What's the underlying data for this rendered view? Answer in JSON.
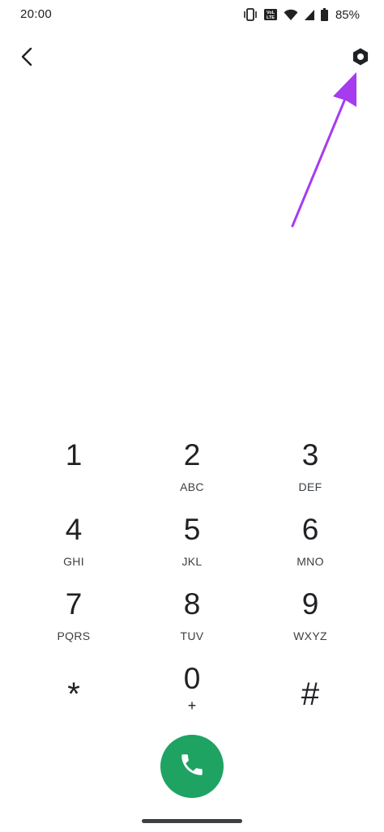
{
  "status_bar": {
    "time": "20:00",
    "battery_percent": "85%",
    "icons": [
      "vibrate-icon",
      "volte-icon",
      "wifi-icon",
      "cell-signal-icon",
      "battery-icon"
    ]
  },
  "app_bar": {
    "back_icon": "chevron-left-icon",
    "settings_icon": "settings-hexagon-icon"
  },
  "annotation": {
    "arrow_color": "#a63bf0"
  },
  "dialpad": {
    "keys": [
      {
        "digit": "1",
        "letters": ""
      },
      {
        "digit": "2",
        "letters": "ABC"
      },
      {
        "digit": "3",
        "letters": "DEF"
      },
      {
        "digit": "4",
        "letters": "GHI"
      },
      {
        "digit": "5",
        "letters": "JKL"
      },
      {
        "digit": "6",
        "letters": "MNO"
      },
      {
        "digit": "7",
        "letters": "PQRS"
      },
      {
        "digit": "8",
        "letters": "TUV"
      },
      {
        "digit": "9",
        "letters": "WXYZ"
      },
      {
        "digit": "*",
        "letters": ""
      },
      {
        "digit": "0",
        "letters": "+"
      },
      {
        "digit": "#",
        "letters": ""
      }
    ]
  },
  "call_button": {
    "icon": "phone-icon",
    "color": "#1ea362"
  }
}
